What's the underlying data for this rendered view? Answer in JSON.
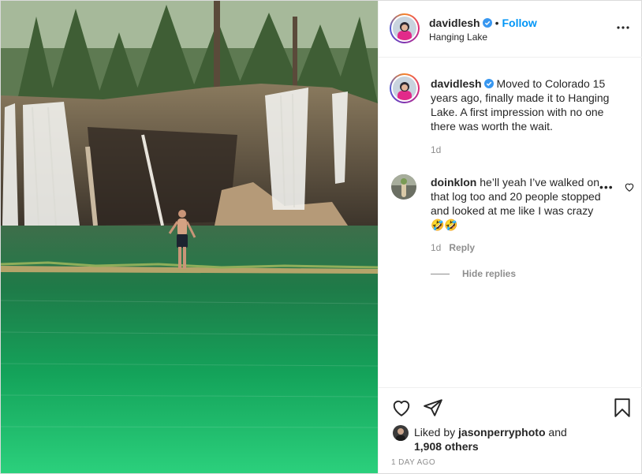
{
  "post": {
    "username": "davidlesh",
    "follow_label": "Follow",
    "separator": "•",
    "location": "Hanging Lake",
    "caption": "Moved to Colorado 15 years ago, finally made it to Hanging Lake. A first impression with no one there was worth the wait.",
    "caption_time": "1d"
  },
  "comment": {
    "username": "doinklon",
    "text": "he’ll yeah I’ve walked on that log too and 20 people stopped and looked at me like I was crazy",
    "emoji": "🤣🤣",
    "more": "•••",
    "time": "1d",
    "reply_label": "Reply",
    "hide_replies_label": "Hide replies"
  },
  "likes": {
    "prefix": "Liked by",
    "liker": "jasonperryphoto",
    "conjunction": "and",
    "others": "1,908 others",
    "timestamp": "1 DAY AGO"
  },
  "icons": {
    "verified": "verified-badge-icon",
    "more": "more-options-icon",
    "heart": "heart-icon",
    "share": "share-icon",
    "save": "bookmark-icon"
  },
  "colors": {
    "accent": "#0095f6",
    "verified": "#3897f0",
    "muted": "#8e8e8e",
    "text": "#262626"
  }
}
